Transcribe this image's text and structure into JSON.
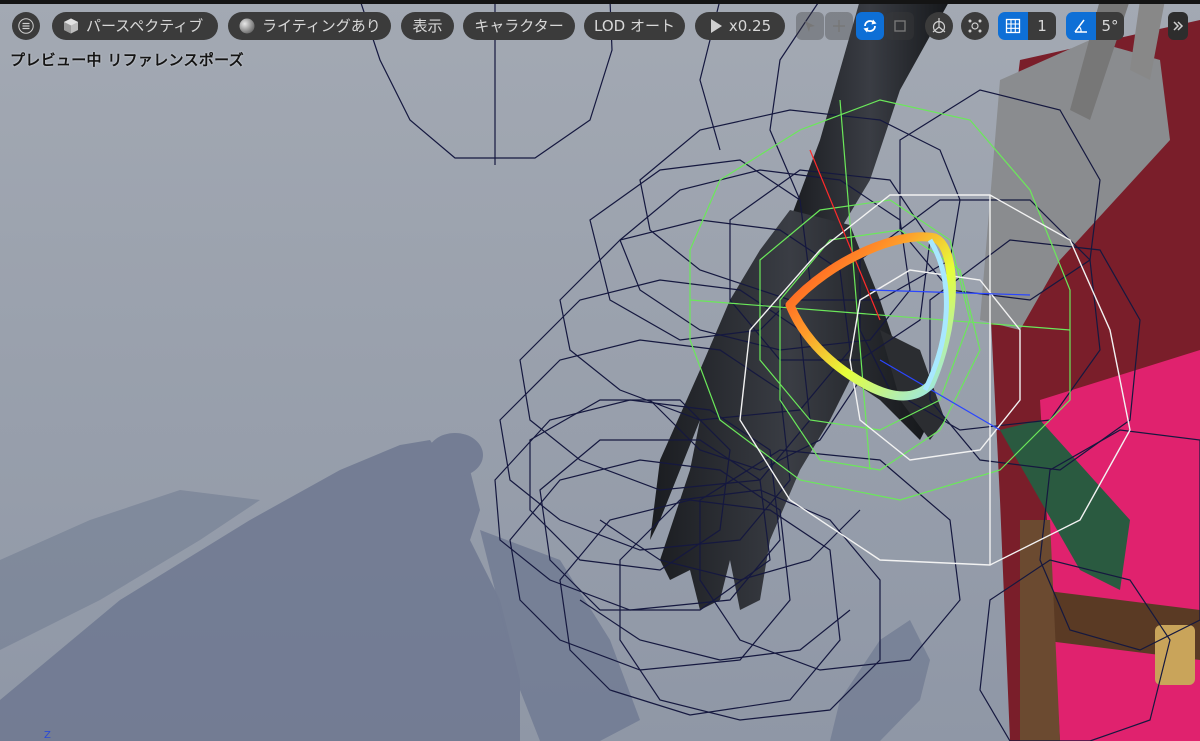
{
  "toolbar": {
    "perspective_label": "パースペクティブ",
    "lighting_label": "ライティングあり",
    "show_label": "表示",
    "character_label": "キャラクター",
    "lod_label": "LOD オート",
    "speed_label": "x0.25",
    "grid_value": "1",
    "angle_value": "5°"
  },
  "viewport": {
    "status_text": "プレビュー中 リファレンスポーズ",
    "axis_label": "Z"
  },
  "icons": {
    "menu": "hamburger-menu-icon",
    "perspective": "cube-icon",
    "lighting": "sphere-icon",
    "play": "play-icon",
    "rotate": "rotate-icon",
    "grid": "grid-icon",
    "angle": "angle-icon",
    "more": "chevron-double-right-icon"
  },
  "colors": {
    "toolbar_button": "#3b3b3b",
    "active_blue": "#0e6fd6",
    "wireframe_navy": "#15183f",
    "wireframe_green": "#6be85a",
    "wireframe_white": "#f2f2f2"
  }
}
